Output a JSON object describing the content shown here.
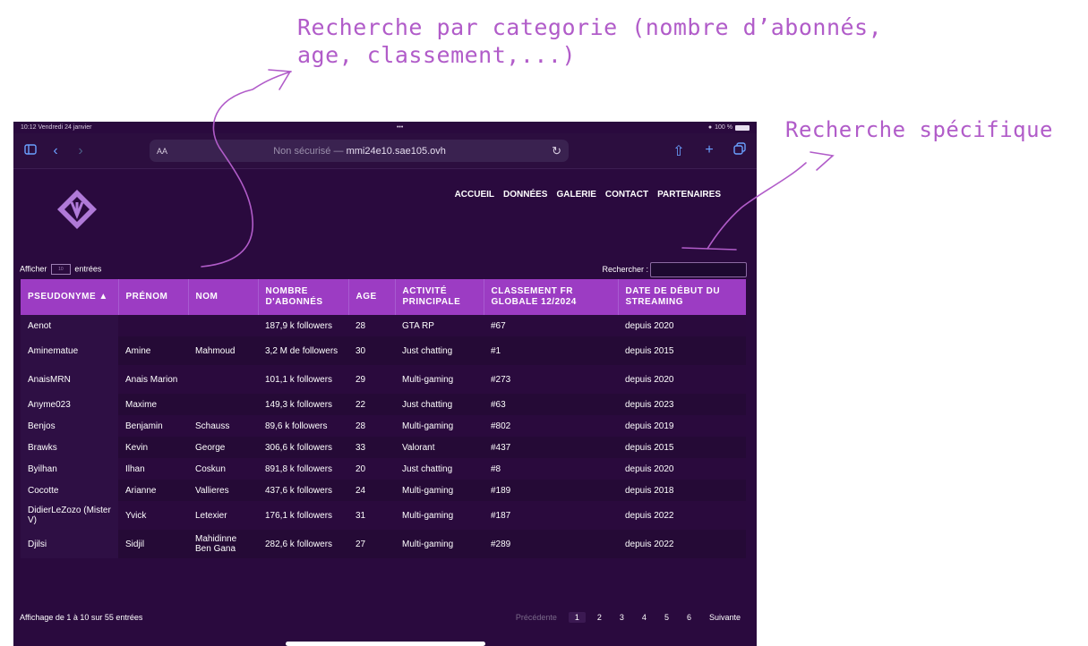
{
  "annotations": {
    "category_line1": "Recherche par categorie (nombre d’abonnés,",
    "category_line2": "age, classement,...)",
    "specific": "Recherche spécifique",
    "color": "#b15cc9"
  },
  "status_bar": {
    "time": "10:12",
    "date": "Vendredi 24 janvier",
    "dots": "•••",
    "battery": "100 %"
  },
  "browser": {
    "aa_label": "AA",
    "security": "Non sécurisé",
    "separator": "—",
    "host": "mmi24e10.sae105.ovh",
    "icons": [
      "sidebar-icon",
      "back-icon",
      "forward-icon",
      "reload-icon",
      "share-icon",
      "new-tab-icon",
      "tabs-icon"
    ]
  },
  "nav": {
    "items": [
      "ACCUEIL",
      "DONNÉES",
      "GALERIE",
      "CONTACT",
      "PARTENAIRES"
    ]
  },
  "table_controls": {
    "show_prefix": "Afficher",
    "show_value": "10",
    "show_suffix": "entrées",
    "search_label": "Rechercher :",
    "search_value": ""
  },
  "table": {
    "headers": [
      "PSEUDONYME ▲",
      "PRÉNOM",
      "NOM",
      "NOMBRE D'ABONNÉS",
      "AGE",
      "ACTIVITÉ PRINCIPALE",
      "CLASSEMENT FR GLOBALE 12/2024",
      "DATE DE DÉBUT DU STREAMING"
    ],
    "rows": [
      [
        "Aenot",
        "",
        "",
        "187,9 k followers",
        "28",
        "GTA RP",
        "#67",
        "depuis 2020"
      ],
      [
        "Aminematue",
        "Amine",
        "Mahmoud",
        "3,2 M de followers",
        "30",
        "Just chatting",
        "#1",
        "depuis 2015"
      ],
      [
        "AnaisMRN",
        "Anais Marion",
        "",
        "101,1 k followers",
        "29",
        "Multi-gaming",
        "#273",
        "depuis 2020"
      ],
      [
        "Anyme023",
        "Maxime",
        "",
        "149,3 k followers",
        "22",
        "Just chatting",
        "#63",
        "depuis 2023"
      ],
      [
        "Benjos",
        "Benjamin",
        "Schauss",
        "89,6 k followers",
        "28",
        "Multi-gaming",
        "#802",
        "depuis 2019"
      ],
      [
        "Brawks",
        "Kevin",
        "George",
        "306,6 k followers",
        "33",
        "Valorant",
        "#437",
        "depuis 2015"
      ],
      [
        "Byilhan",
        "Ilhan",
        "Coskun",
        "891,8 k followers",
        "20",
        "Just chatting",
        "#8",
        "depuis 2020"
      ],
      [
        "Cocotte",
        "Arianne",
        "Vallieres",
        "437,6 k followers",
        "24",
        "Multi-gaming",
        "#189",
        "depuis 2018"
      ],
      [
        "DidierLeZozo (Mister V)",
        "Yvick",
        "Letexier",
        "176,1 k followers",
        "31",
        "Multi-gaming",
        "#187",
        "depuis 2022"
      ],
      [
        "Djilsi",
        "Sidjil",
        "Mahidinne Ben Gana",
        "282,6 k followers",
        "27",
        "Multi-gaming",
        "#289",
        "depuis 2022"
      ]
    ]
  },
  "footer": {
    "info": "Affichage de 1 à 10 sur 55 entrées",
    "prev": "Précédente",
    "pages": [
      "1",
      "2",
      "3",
      "4",
      "5",
      "6"
    ],
    "next": "Suivante",
    "current_page": "1"
  },
  "colors": {
    "header_bg": "#9c3cc3",
    "page_bg": "#2a0a3e",
    "logo": "#b07ad8"
  }
}
